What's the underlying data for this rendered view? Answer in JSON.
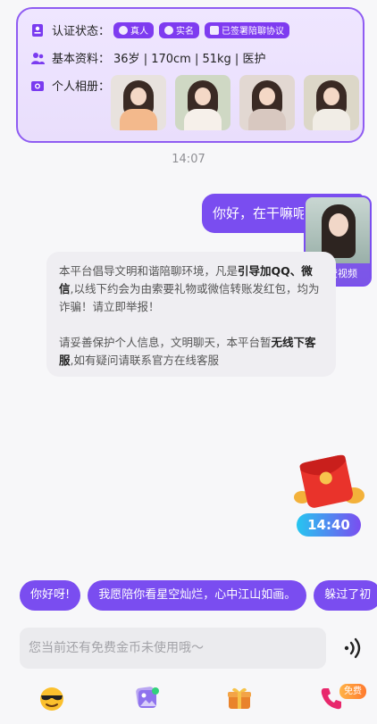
{
  "profile": {
    "cert_label": "认证状态：",
    "badges": [
      "真人",
      "实名",
      "已签署陪聊协议"
    ],
    "basic_label": "基本资料：",
    "basic_value": "36岁 | 170cm | 51kg | 医护",
    "album_label": "个人相册："
  },
  "chat": {
    "timestamp1": "14:07",
    "outgoing_message": "你好，在干嘛呢",
    "video_label": "免费视频",
    "notice_p1_a": "本平台倡导文明和谐陪聊环境，凡是",
    "notice_p1_b": "引导加QQ、微信",
    "notice_p1_c": ",以线下约会为由索要礼物或微信转账发红包，均为诈骗！请立即举报！",
    "notice_p2_a": "请妥善保护个人信息，文明聊天，本平台暂",
    "notice_p2_b": "无线下客服",
    "notice_p2_c": ",如有疑问请联系官方在线客服",
    "timestamp2": "14:40"
  },
  "quick_replies": [
    "你好呀!",
    "我愿陪你看星空灿烂，心中江山如画。",
    "躲过了初"
  ],
  "input": {
    "placeholder": "您当前还有免费金币未使用哦～"
  },
  "toolbar": {
    "free_badge": "免费"
  },
  "colors": {
    "accent": "#7a4df0",
    "card_border": "#8f5cf2",
    "card_bg": "#efe6ff"
  },
  "icons": [
    "id-card-icon",
    "person-icon",
    "album-icon",
    "voice-icon",
    "emoji-sunglasses-icon",
    "gallery-icon",
    "gift-box-icon",
    "phone-video-icon"
  ]
}
